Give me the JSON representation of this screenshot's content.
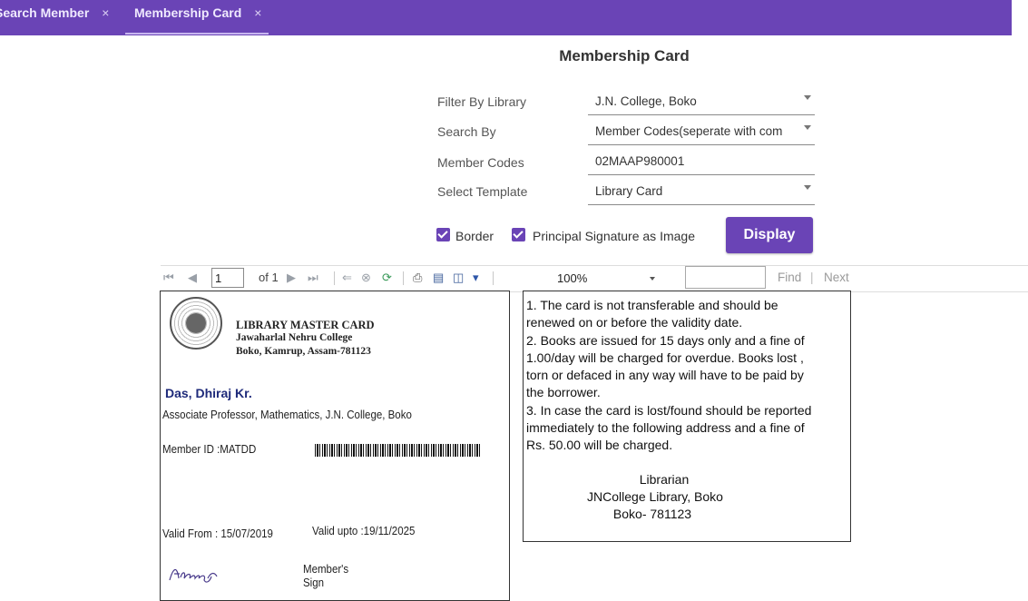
{
  "tabs": [
    {
      "label": "Search Member",
      "close": "×"
    },
    {
      "label": "Membership Card",
      "close": "×"
    }
  ],
  "form": {
    "title": "Membership Card",
    "filter_label": "Filter By Library",
    "filter_value": "J.N. College, Boko",
    "search_by_label": "Search By",
    "search_by_value": "Member Codes(seperate with com",
    "member_codes_label": "Member Codes",
    "member_codes_value": "02MAAP980001",
    "template_label": "Select Template",
    "template_value": "Library Card",
    "border_label": "Border",
    "principal_sig_label": "Principal Signature as Image",
    "display_button": "Display",
    "accent_color": "#6a44b6"
  },
  "viewer": {
    "page_number": "1",
    "of_pages": "of 1",
    "zoom": "100%",
    "find_label": "Find",
    "next_label": "Next",
    "sep": "|",
    "icons": [
      "first-page-icon",
      "prev-page-icon",
      "next-page-icon",
      "last-page-icon",
      "back-icon",
      "stop-icon",
      "refresh-icon",
      "print-icon",
      "print-layout-icon",
      "page-setup-icon",
      "export-icon"
    ]
  },
  "card_front": {
    "heading1": "LIBRARY MASTER CARD",
    "heading2": "Jawaharlal Nehru College",
    "heading3": "Boko, Kamrup, Assam-781123",
    "member_name": "Das, Dhiraj Kr.",
    "member_desc": "Associate Professor, Mathematics, J.N. College, Boko",
    "member_id": "Member ID :MATDD",
    "valid_from": "Valid From : 15/07/2019",
    "valid_upto": "Valid upto :19/11/2025",
    "signature": "Abaishya",
    "member_sign_1": "Member's",
    "member_sign_2": "Sign"
  },
  "card_back": {
    "lines": [
      "1. The card is not transferable and should be",
      "renewed on or before the validity date.",
      "2. Books are issued for 15 days only and a fine of",
      "1.00/day will be charged for overdue. Books lost ,",
      "torn or defaced in any way will have to be paid by",
      "the borrower.",
      "3. In case the card is lost/found should be reported",
      "immediately to the following address and a fine of",
      "Rs. 50.00 will be charged."
    ],
    "addr1": "Librarian",
    "addr2": "JNCollege Library, Boko",
    "addr3": "Boko- 781123"
  }
}
